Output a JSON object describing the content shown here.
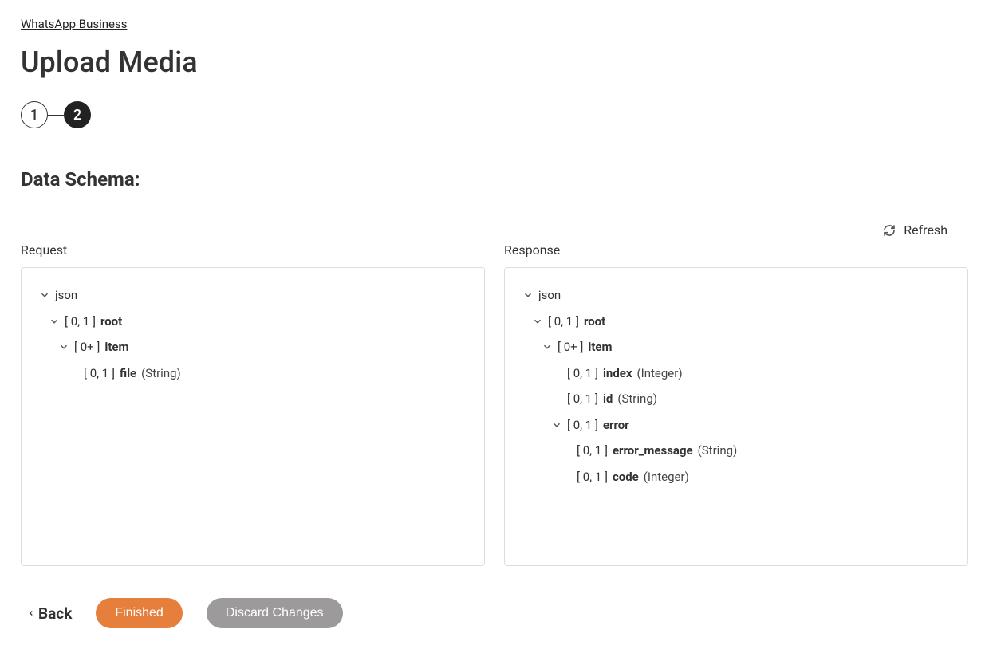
{
  "breadcrumb": "WhatsApp Business",
  "page_title": "Upload Media",
  "stepper": {
    "step1": "1",
    "step2": "2"
  },
  "section_title": "Data Schema:",
  "refresh_label": "Refresh",
  "columns": {
    "request_label": "Request",
    "response_label": "Response"
  },
  "request_tree": {
    "json_label": "json",
    "root_card": "[ 0, 1 ]",
    "root_name": "root",
    "item_card": "[ 0+ ]",
    "item_name": "item",
    "file_card": "[ 0, 1 ]",
    "file_name": "file",
    "file_type": "(String)"
  },
  "response_tree": {
    "json_label": "json",
    "root_card": "[ 0, 1 ]",
    "root_name": "root",
    "item_card": "[ 0+ ]",
    "item_name": "item",
    "index_card": "[ 0, 1 ]",
    "index_name": "index",
    "index_type": "(Integer)",
    "id_card": "[ 0, 1 ]",
    "id_name": "id",
    "id_type": "(String)",
    "error_card": "[ 0, 1 ]",
    "error_name": "error",
    "error_message_card": "[ 0, 1 ]",
    "error_message_name": "error_message",
    "error_message_type": "(String)",
    "code_card": "[ 0, 1 ]",
    "code_name": "code",
    "code_type": "(Integer)"
  },
  "actions": {
    "back": "Back",
    "finished": "Finished",
    "discard": "Discard Changes"
  }
}
